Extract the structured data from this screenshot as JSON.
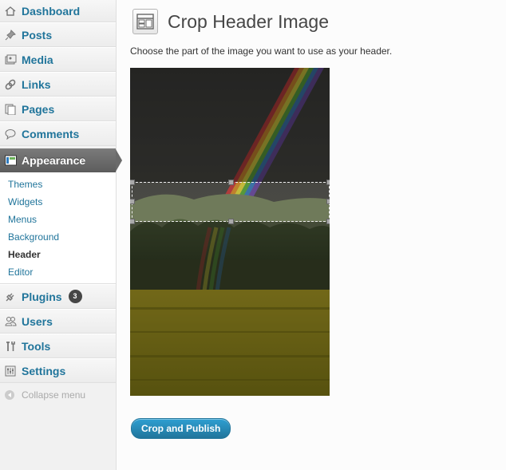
{
  "sidebar": {
    "items": [
      {
        "label": "Dashboard",
        "icon": "dashboard-icon"
      },
      {
        "label": "Posts",
        "icon": "pin-icon"
      },
      {
        "label": "Media",
        "icon": "media-icon"
      },
      {
        "label": "Links",
        "icon": "link-icon"
      },
      {
        "label": "Pages",
        "icon": "pages-icon"
      },
      {
        "label": "Comments",
        "icon": "comment-icon"
      },
      {
        "label": "Appearance",
        "icon": "appearance-icon"
      },
      {
        "label": "Plugins",
        "icon": "plug-icon",
        "badge": "3"
      },
      {
        "label": "Users",
        "icon": "users-icon"
      },
      {
        "label": "Tools",
        "icon": "tools-icon"
      },
      {
        "label": "Settings",
        "icon": "settings-icon"
      }
    ],
    "submenu": [
      "Themes",
      "Widgets",
      "Menus",
      "Background",
      "Header",
      "Editor"
    ],
    "current_submenu": "Header",
    "collapse_label": "Collapse menu"
  },
  "main": {
    "title": "Crop Header Image",
    "instructions": "Choose the part of the image you want to use as your header.",
    "button_label": "Crop and Publish"
  },
  "colors": {
    "link": "#21759b",
    "active_menu": "#6a6a6a",
    "button": "#21759b"
  }
}
